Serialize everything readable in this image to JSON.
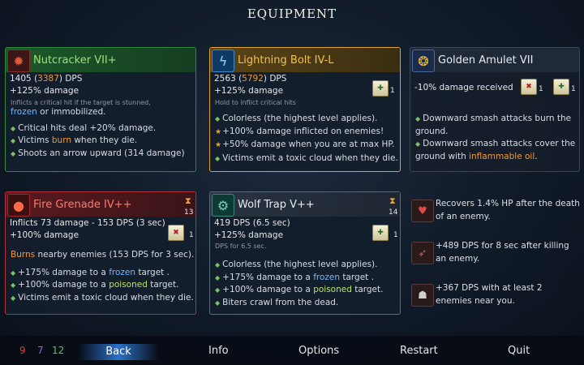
{
  "title": "EQUIPMENT",
  "weapons": [
    {
      "name": "Nutcracker VII+",
      "dps_base": "1405",
      "dps_open": " (",
      "dps_bonus": "3387",
      "dps_close": ") DPS",
      "bonus": "+125% damage",
      "cut_text": "Inflicts a critical hit if the target is stunned,",
      "line_a": "frozen",
      "line_b": " or immobilized.",
      "effects": [
        {
          "text": "Critical hits deal +20% damage."
        },
        {
          "pre": "Victims ",
          "hl": "burn",
          "post": " when they die."
        },
        {
          "text": "Shoots an arrow upward (314 damage)"
        }
      ],
      "colors": {
        "border": "#2f8a3c",
        "head": "#1d5a2a",
        "name": "#9fe07a"
      }
    },
    {
      "name": "Lightning Bolt IV-L",
      "dps_base": "2563",
      "dps_open": " (",
      "dps_bonus": "5792",
      "dps_close": ") DPS",
      "bonus": "+125% damage",
      "scroll_count": "1",
      "cut_text": "Hold to inflict critical hits",
      "effects": [
        {
          "text": "Colorless (the highest level applies)."
        },
        {
          "star": true,
          "text": "+100% damage inflicted on enemies!"
        },
        {
          "star": true,
          "text": "+50% damage when you are at max HP."
        },
        {
          "text": "Victims emit a toxic cloud when they die."
        }
      ],
      "colors": {
        "border": "#e0a22a",
        "head": "#5a4516",
        "name": "#f5c04a"
      }
    },
    {
      "name": "Fire Grenade IV++",
      "cooldown": "13",
      "scroll_count": "1",
      "dps_line": "Inflicts 73 damage - 153 DPS (3 sec)",
      "bonus": "+100% damage",
      "burns_hl": "Burns",
      "burns_rest": " nearby enemies (153 DPS for 3 sec).",
      "effects": [
        {
          "pre": "+175% damage to a ",
          "hl": "frozen",
          "hlclass": "blue",
          "post": " target ."
        },
        {
          "pre": "+100% damage to a ",
          "hl": "poisoned",
          "hlclass": "green",
          "post": " target."
        },
        {
          "text": "Victims emit a toxic cloud when they die."
        }
      ],
      "colors": {
        "border": "#b8303a",
        "head": "#5a1a20",
        "name": "#ff7a6a"
      }
    },
    {
      "name": "Wolf Trap V++",
      "cooldown": "14",
      "scroll_count": "1",
      "dps_line": "419 DPS (6.5 sec)",
      "bonus": "+125% damage",
      "cut_text": "DPS for 6.5 sec.",
      "effects": [
        {
          "text": "Colorless (the highest level applies)."
        },
        {
          "pre": "+175% damage to a ",
          "hl": "frozen",
          "hlclass": "blue",
          "post": " target ."
        },
        {
          "pre": "+100% damage to a ",
          "hl": "poisoned",
          "hlclass": "green",
          "post": " target."
        },
        {
          "text": "Biters crawl from the dead."
        }
      ],
      "colors": {
        "border": "#5a6a7e",
        "head": "#2a3442",
        "name": "#e8ecf2"
      }
    }
  ],
  "amulet": {
    "name": "Golden Amulet VII",
    "stat": "-10% damage received",
    "scroll_count_a": "1",
    "scroll_count_b": "1",
    "effects": [
      {
        "text": "Downward smash attacks burn the",
        "text2": "ground."
      },
      {
        "text": "Downward smash attacks cover the",
        "pre2": "ground with ",
        "hl": "inflammable oil",
        "post2": "."
      }
    ]
  },
  "mutations": [
    {
      "icon": "heart-leech-icon",
      "text": "Recovers 1.4% HP after the death of an enemy."
    },
    {
      "icon": "bow-kill-icon",
      "text": "+489 DPS for 8 sec after killing an enemy."
    },
    {
      "icon": "crowd-icon",
      "text": "+367 DPS with at least 2 enemies near you."
    }
  ],
  "scrolls": {
    "brutality": "9",
    "tactics": "7",
    "survival": "12",
    "colors": {
      "brutality": "#e0383a",
      "tactics": "#a55be8",
      "survival": "#4ac86a"
    }
  },
  "menu": {
    "back": "Back",
    "info": "Info",
    "options": "Options",
    "restart": "Restart",
    "quit": "Quit"
  }
}
